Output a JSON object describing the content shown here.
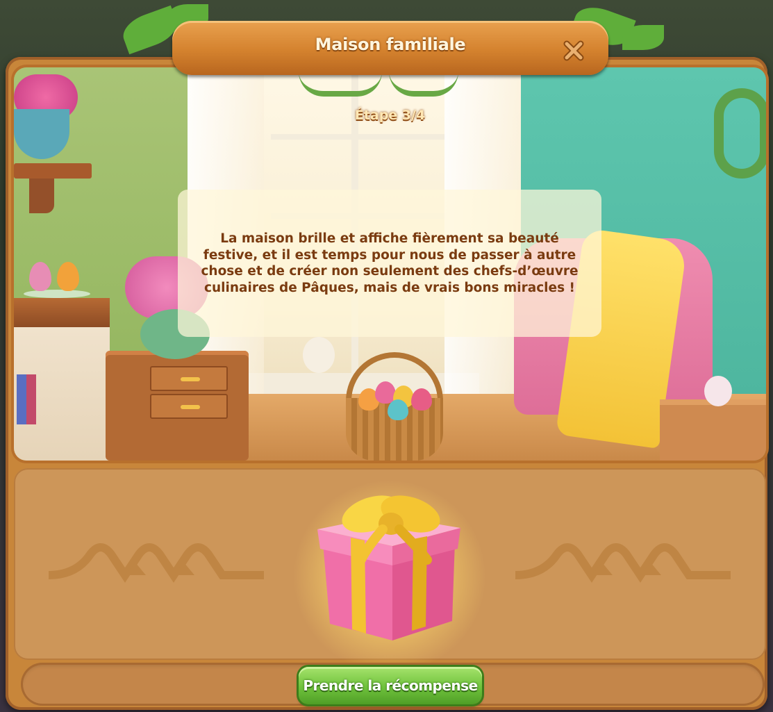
{
  "dialog": {
    "title": "Maison familiale",
    "close_icon": "close-icon",
    "step": "Étape 3/4",
    "story_text": "La maison brille et affiche fièrement sa beauté festive, et il est temps pour nous de passer à autre chose et de créer non seulement des chefs-d’œuvre culinaires de Pâques, mais de vrais bons miracles !"
  },
  "reward": {
    "icon": "gift-box-icon",
    "claim_label": "Prendre la récompense"
  },
  "colors": {
    "frame": "#c8863a",
    "title_plate": "#d4822e",
    "title_text": "#fff6df",
    "story_text": "#7a3b10",
    "claim_button": "#6fc23c"
  }
}
